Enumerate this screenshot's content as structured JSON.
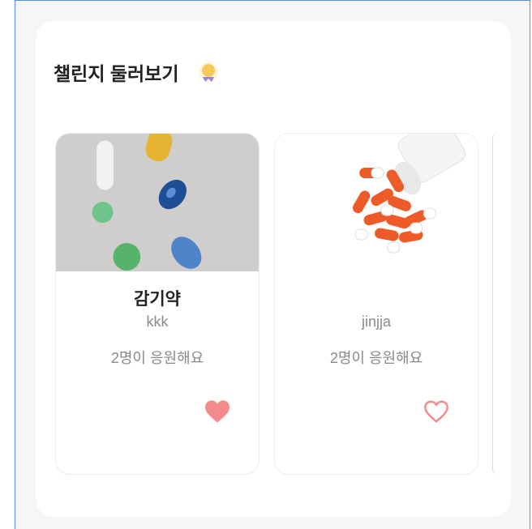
{
  "section": {
    "title": "챌린지 둘러보기"
  },
  "challenges": [
    {
      "title": "감기약",
      "author": "kkk",
      "cheer": "2명이 응원해요",
      "liked": true
    },
    {
      "title": "",
      "author": "jinjja",
      "cheer": "2명이 응원해요",
      "liked": false
    }
  ],
  "colors": {
    "heart": "#f48b8b",
    "badge": "#f7c85a"
  }
}
